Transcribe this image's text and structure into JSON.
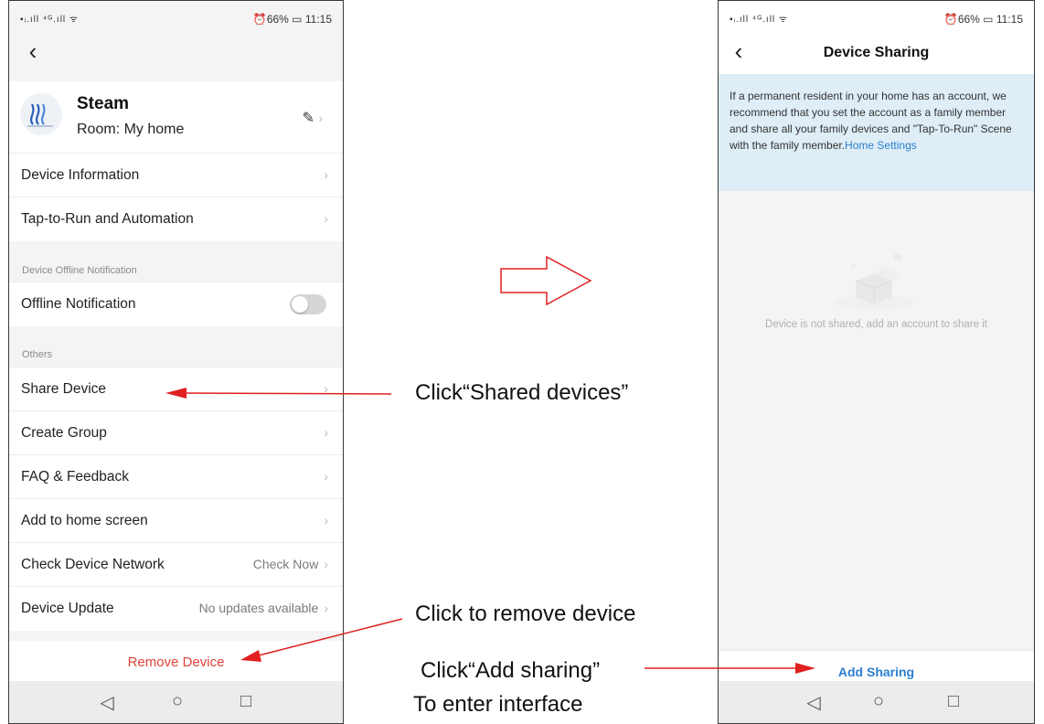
{
  "left_phone": {
    "status_left": "▪ᵢ.ıll ⁴ᴳ.ıll ᯤ",
    "status_right": "⏰66% ▭ 11:15",
    "back_icon": "chevron-left-icon",
    "device": {
      "name": "Steam",
      "room_label": "Room:",
      "room_value": "My home"
    },
    "rows_top": [
      {
        "label": "Device Information"
      },
      {
        "label": "Tap-to-Run and Automation"
      }
    ],
    "offline_section_label": "Device Offline Notification",
    "offline_row_label": "Offline Notification",
    "offline_toggle_on": false,
    "others_section_label": "Others",
    "rows_others": [
      {
        "label": "Share Device"
      },
      {
        "label": "Create Group"
      },
      {
        "label": "FAQ & Feedback"
      },
      {
        "label": "Add to home screen"
      },
      {
        "label": "Check Device Network",
        "right": "Check Now"
      },
      {
        "label": "Device Update",
        "right": "No updates available"
      }
    ],
    "remove_label": "Remove Device"
  },
  "right_phone": {
    "status_left": "▪ᵢ.ıll ⁴ᴳ.ıll ᯤ",
    "status_right": "⏰66% ▭ 11:15",
    "title": "Device Sharing",
    "info_text": "If a permanent resident in your home has an account, we recommend that you set the account as a family member and share all your family devices and \"Tap-To-Run\" Scene with the family member.",
    "info_link": "Home Settings",
    "empty_text": "Device is not shared, add an account to share it",
    "add_sharing_label": "Add Sharing"
  },
  "annotations": {
    "shared_devices": "Click“Shared devices”",
    "remove_device": "Click to remove device",
    "add_sharing_line1": "Click“Add sharing”",
    "add_sharing_line2": "To enter interface"
  },
  "colors": {
    "accent_blue": "#2d80d0",
    "remove_red": "#e0433a",
    "arrow_red": "#e02020",
    "banner_bg": "#deedf6"
  }
}
